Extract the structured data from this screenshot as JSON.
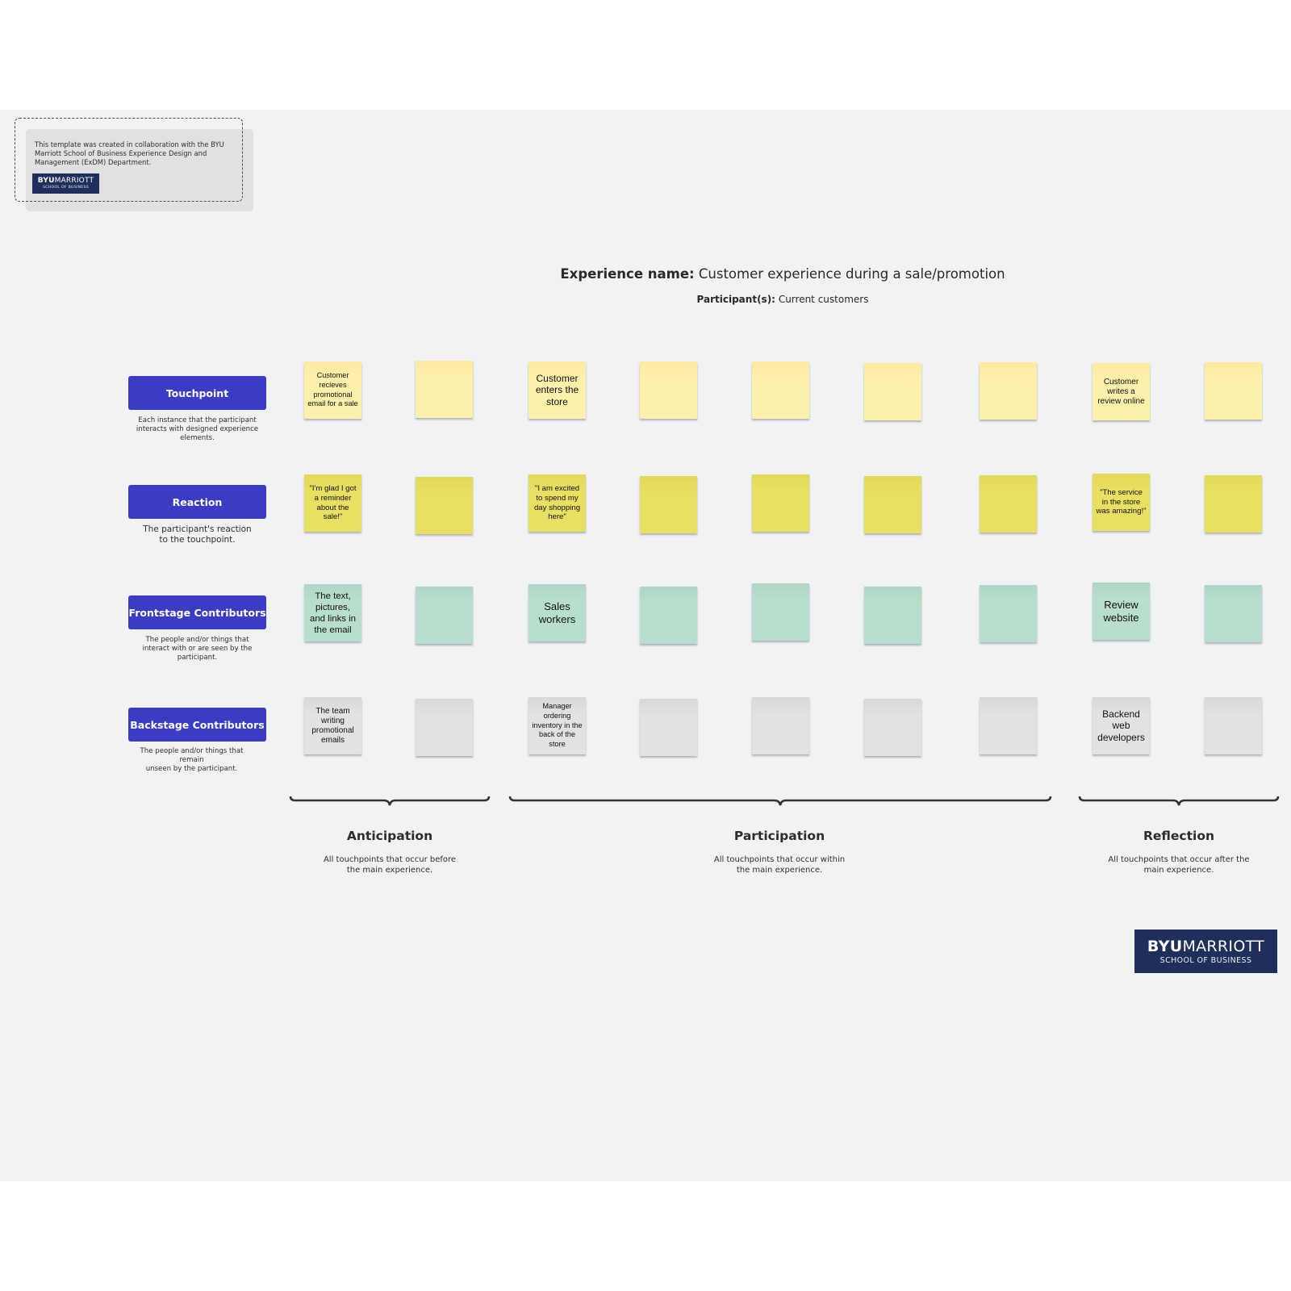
{
  "attribution": {
    "text": "This template was created in collaboration with the BYU Marriott School of Business Experience Design and Management (ExDM) Department.",
    "logo_bold": "BYU",
    "logo_light": "MARRIOTT",
    "logo_sub": "SCHOOL OF BUSINESS"
  },
  "header": {
    "experience_label": "Experience name:",
    "experience_value": "Customer experience during a sale/promotion",
    "participants_label": "Participant(s):",
    "participants_value": "Current customers"
  },
  "rows": [
    {
      "label": "Touchpoint",
      "description": "Each instance that the participant interacts with designed experience elements."
    },
    {
      "label": "Reaction",
      "description": "The participant's reaction to the touchpoint."
    },
    {
      "label": "Frontstage Contributors",
      "description": "The people and/or things that interact with or are seen by the participant."
    },
    {
      "label": "Backstage Contributors",
      "description": "The people and/or things that remain\nunseen by the participant."
    }
  ],
  "notes": {
    "touchpoint": [
      "Customer recieves promotional email for a sale",
      "",
      "Customer enters the store",
      "",
      "",
      "",
      "",
      "Customer writes a review online",
      ""
    ],
    "reaction": [
      "\"I'm glad I got a reminder about the sale!\"",
      "",
      "\"I am excited to spend my day shopping here\"",
      "",
      "",
      "",
      "",
      "\"The service in the store was amazing!\"",
      ""
    ],
    "frontstage": [
      "The text, pictures, and links in the email",
      "",
      "Sales workers",
      "",
      "",
      "",
      "",
      "Review website",
      ""
    ],
    "backstage": [
      "The team writing promotional emails",
      "",
      "Manager ordering inventory in the back of the store",
      "",
      "",
      "",
      "",
      "Backend web developers",
      ""
    ]
  },
  "colors": {
    "row_label_bg": "#3a3dc4",
    "touchpoint_note": "#fdf0aa",
    "reaction_note": "#e8e062",
    "frontstage_note": "#b8dfcd",
    "backstage_note": "#e2e2e2",
    "logo_bg": "#1e2f5c",
    "canvas_bg": "#f1f2f4"
  },
  "phases": [
    {
      "title": "Anticipation",
      "description": "All touchpoints that occur before the main experience."
    },
    {
      "title": "Participation",
      "description": "All touchpoints that occur within the main experience."
    },
    {
      "title": "Reflection",
      "description": "All touchpoints that occur after the main experience."
    }
  ],
  "footer_logo": {
    "bold": "BYU",
    "light": "MARRIOTT",
    "sub": "SCHOOL OF BUSINESS"
  }
}
